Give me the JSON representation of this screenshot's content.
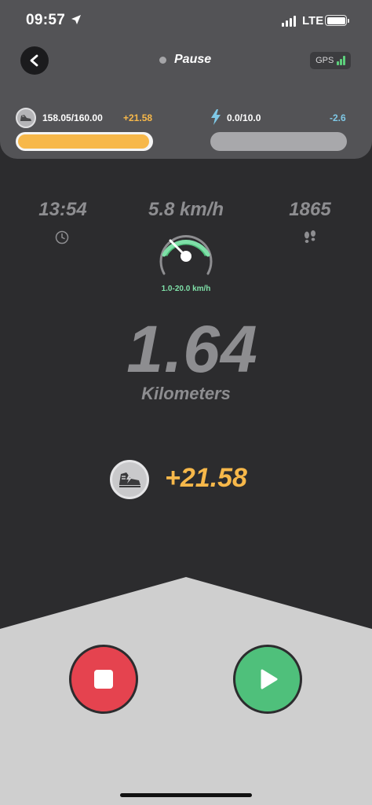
{
  "status_bar": {
    "time": "09:57",
    "network": "LTE"
  },
  "header": {
    "status_label": "Pause",
    "gps_label": "GPS"
  },
  "energy": {
    "value": "158.05/160.00",
    "delta": "+21.58",
    "progress": 0.99
  },
  "stamina": {
    "value": "0.0/10.0",
    "delta": "-2.6",
    "progress": 0.0
  },
  "stats": {
    "time": "13:54",
    "speed": "5.8 km/h",
    "steps": "1865",
    "speed_range": "1.0-20.0 km/h"
  },
  "distance": {
    "value": "1.64",
    "unit": "Kilometers"
  },
  "reward": {
    "value": "+21.58"
  },
  "colors": {
    "accent_yellow": "#f7b84a",
    "accent_green": "#4fc07b",
    "stop_red": "#e5434f",
    "stamina_blue": "#7fc8e6"
  },
  "icons": {
    "back": "chevron-left-icon",
    "energy": "sneaker-icon",
    "stamina": "lightning-bolt-icon",
    "time": "clock-icon",
    "steps": "footprints-icon",
    "stop": "stop-icon",
    "play": "play-icon"
  }
}
